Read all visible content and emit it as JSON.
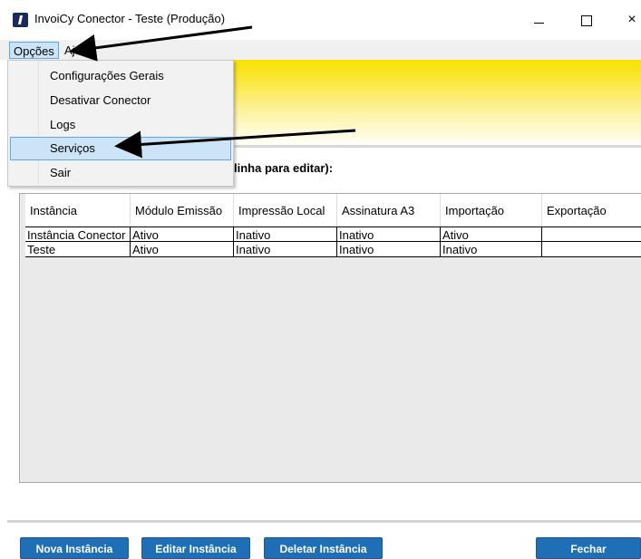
{
  "window": {
    "title": "InvoiCy Conector - Teste (Produção)",
    "minimize": "",
    "maximize": "",
    "close": "×"
  },
  "menubar": {
    "opcoes": "Opções",
    "ajuda": "Ajuda"
  },
  "dropdown": {
    "items": [
      {
        "label": "Configurações Gerais"
      },
      {
        "label": "Desativar Conector"
      },
      {
        "label": "Logs"
      },
      {
        "label": "Serviços"
      },
      {
        "label": "Sair"
      }
    ],
    "highlighted": "Serviços"
  },
  "instruction": "linha para editar):",
  "table": {
    "columns": [
      "Instância",
      "Módulo Emissão",
      "Impressão Local",
      "Assinatura A3",
      "Importação",
      "Exportação"
    ],
    "rows": [
      [
        "Instância Conector",
        "Ativo",
        "Inativo",
        "Inativo",
        "Ativo",
        ""
      ],
      [
        "Teste",
        "Ativo",
        "Inativo",
        "Inativo",
        "Inativo",
        ""
      ]
    ]
  },
  "buttons": {
    "nova": "Nova Instância",
    "editar": "Editar Instância",
    "deletar": "Deletar Instância",
    "fechar": "Fechar"
  },
  "colors": {
    "button_blue": "#1f6fb7",
    "menu_highlight": "#cce4f7",
    "banner_yellow": "#f8e100"
  }
}
